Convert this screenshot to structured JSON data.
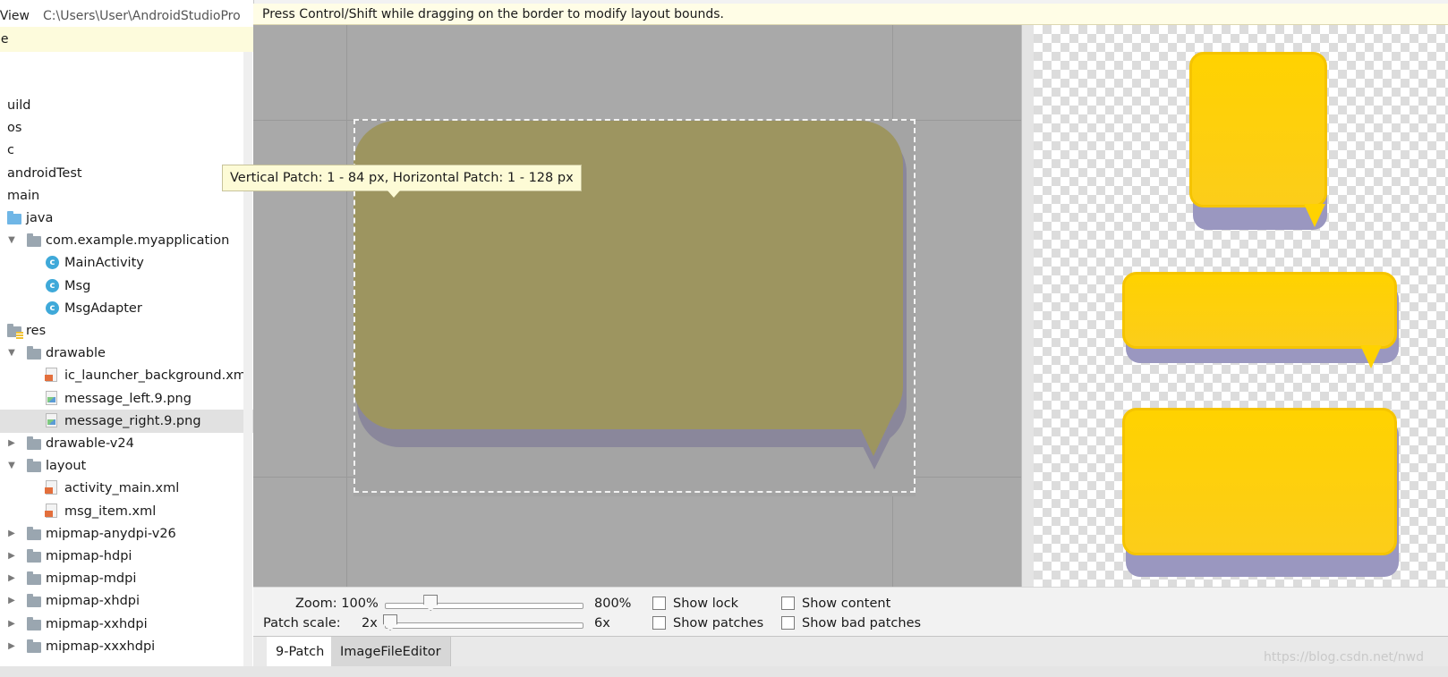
{
  "sidebar": {
    "header_title": "rView",
    "header_path": "C:\\Users\\User\\AndroidStudioPro",
    "selected_row_label": "le",
    "rows": [
      {
        "label": "uild",
        "icon": "none",
        "indent": 0
      },
      {
        "label": "os",
        "icon": "none",
        "indent": 0
      },
      {
        "label": "c",
        "icon": "none",
        "indent": 0
      },
      {
        "label": "androidTest",
        "icon": "none",
        "indent": 0
      },
      {
        "label": "main",
        "icon": "none",
        "indent": 0
      },
      {
        "label": "java",
        "icon": "folder-blue-icon",
        "indent": 1
      },
      {
        "label": "com.example.myapplication",
        "icon": "package-icon",
        "indent": 2
      },
      {
        "label": "MainActivity",
        "icon": "class-icon",
        "indent": 3
      },
      {
        "label": "Msg",
        "icon": "class-icon",
        "indent": 3
      },
      {
        "label": "MsgAdapter",
        "icon": "class-icon",
        "indent": 3
      },
      {
        "label": "res",
        "icon": "res-folder-icon",
        "indent": 1
      },
      {
        "label": "drawable",
        "icon": "folder-icon",
        "indent": 2
      },
      {
        "label": "ic_launcher_background.xml",
        "icon": "xml-file-icon",
        "indent": 3
      },
      {
        "label": "message_left.9.png",
        "icon": "image-file-icon",
        "indent": 3
      },
      {
        "label": "message_right.9.png",
        "icon": "image-file-icon",
        "indent": 3
      },
      {
        "label": "drawable-v24",
        "icon": "folder-icon",
        "indent": 2
      },
      {
        "label": "layout",
        "icon": "folder-icon",
        "indent": 2
      },
      {
        "label": "activity_main.xml",
        "icon": "xml-file-icon",
        "indent": 3
      },
      {
        "label": "msg_item.xml",
        "icon": "xml-file-icon",
        "indent": 3
      },
      {
        "label": "mipmap-anydpi-v26",
        "icon": "folder-icon",
        "indent": 2
      },
      {
        "label": "mipmap-hdpi",
        "icon": "folder-icon",
        "indent": 2
      },
      {
        "label": "mipmap-mdpi",
        "icon": "folder-icon",
        "indent": 2
      },
      {
        "label": "mipmap-xhdpi",
        "icon": "folder-icon",
        "indent": 2
      },
      {
        "label": "mipmap-xxhdpi",
        "icon": "folder-icon",
        "indent": 2
      },
      {
        "label": "mipmap-xxxhdpi",
        "icon": "folder-icon",
        "indent": 2
      }
    ]
  },
  "editor": {
    "hint": "Press Control/Shift while dragging on the border to modify layout bounds.",
    "tooltip": "Vertical Patch: 1 - 84 px, Horizontal Patch: 1 - 128 px"
  },
  "controls": {
    "zoom_label": "Zoom: 100%",
    "zoom_max": "800%",
    "zoom_level": 0.06,
    "patch_scale_label": "Patch scale:",
    "patch_scale_min": "2x",
    "patch_scale_max": "6x",
    "patch_scale_level": 0.0,
    "show_lock": "Show lock",
    "show_patches": "Show patches",
    "show_content": "Show content",
    "show_bad_patches": "Show bad patches"
  },
  "tabs": [
    {
      "label": "9-Patch",
      "active": true
    },
    {
      "label": "ImageFileEditor",
      "active": false
    }
  ],
  "watermark": "https://blog.csdn.net/nwd",
  "colors": {
    "bubble_yellow": "#ffd200",
    "bubble_shadow": "#9a97c0",
    "hint_bg": "#fffde6",
    "selection_bg": "#e1e1e1"
  }
}
